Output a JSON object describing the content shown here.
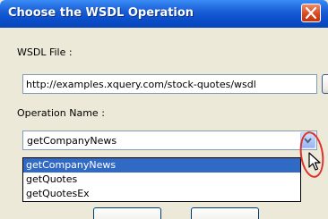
{
  "dialog": {
    "title": "Choose the WSDL Operation",
    "close_icon": "close-icon",
    "accent_color": "#0a4cc8",
    "close_color": "#d9441c"
  },
  "wsdl_file": {
    "label": "WSDL File :",
    "value": "http://examples.xquery.com/stock-quotes/wsdl",
    "browse_label": "..."
  },
  "operation": {
    "label": "Operation Name :",
    "selected": "getCompanyNews",
    "dropdown_icon": "chevron-down-icon",
    "options": [
      "getCompanyNews",
      "getQuotes",
      "getQuotesEx"
    ],
    "highlight_color": "#316ac5"
  },
  "annotation": {
    "ring_color": "#e0302a",
    "cursor_icon": "mouse-pointer-icon"
  }
}
